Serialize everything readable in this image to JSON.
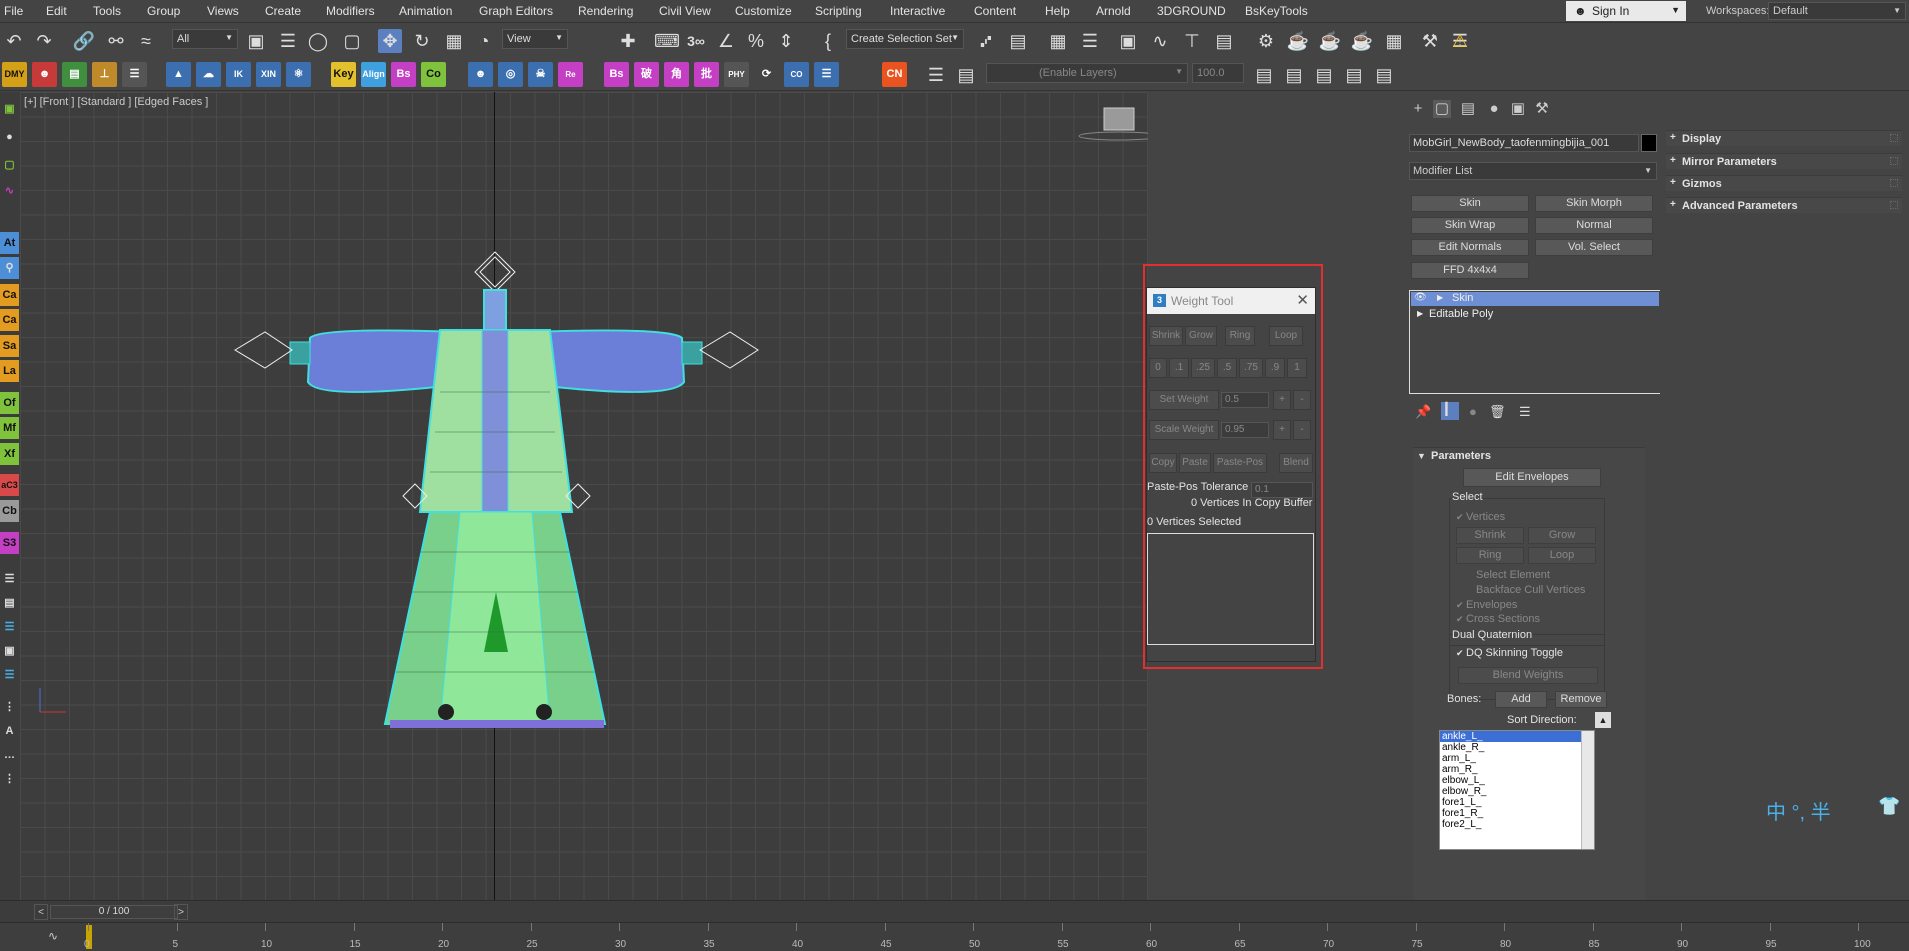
{
  "menu": [
    "File",
    "Edit",
    "Tools",
    "Group",
    "Views",
    "Create",
    "Modifiers",
    "Animation",
    "Graph Editors",
    "Rendering",
    "Civil View",
    "Customize",
    "Scripting",
    "Interactive",
    "Content",
    "Help",
    "Arnold",
    "3DGROUND",
    "BsKeyTools"
  ],
  "account": {
    "sign_in": "Sign In",
    "workspaces_label": "Workspaces:",
    "workspace": "Default"
  },
  "toolbar": {
    "filter": "All",
    "ref_coord": "View",
    "selection_set": "Create Selection Set",
    "layers_placeholder": "(Enable Layers)",
    "layer_value": "100.0"
  },
  "toolbar2_buttons": [
    {
      "label": "Key",
      "color": "#e3c12c"
    },
    {
      "label": "Align",
      "color": "#3fa0e0"
    },
    {
      "label": "Bs",
      "color": "#c43fc4"
    },
    {
      "label": "Co",
      "color": "#7fc23c"
    },
    {
      "label": "Bs",
      "color": "#c43fc4"
    },
    {
      "label": "破",
      "color": "#c43fc4"
    },
    {
      "label": "角",
      "color": "#c43fc4"
    },
    {
      "label": "批",
      "color": "#c43fc4"
    },
    {
      "label": "CN",
      "color": "#e8531f"
    }
  ],
  "left_strip": [
    {
      "label": "At",
      "color": "#4d8fd6"
    },
    {
      "label": "Ca",
      "color": "#e39b20"
    },
    {
      "label": "Ca",
      "color": "#e39b20"
    },
    {
      "label": "Sa",
      "color": "#e39b20"
    },
    {
      "label": "La",
      "color": "#e39b20"
    },
    {
      "label": "Of",
      "color": "#7fc23c"
    },
    {
      "label": "Mf",
      "color": "#7fc23c"
    },
    {
      "label": "Xf",
      "color": "#7fc23c"
    },
    {
      "label": "aC3",
      "color": "#d84a4a"
    },
    {
      "label": "Cb",
      "color": "#9a9a9a"
    },
    {
      "label": "S3",
      "color": "#c43fc4"
    }
  ],
  "viewport": {
    "label": "[+] [Front ] [Standard ] [Edged Faces ]"
  },
  "weight_tool": {
    "title": "Weight Tool",
    "row1": [
      "Shrink",
      "Grow",
      "Ring",
      "Loop"
    ],
    "row2": [
      "0",
      ".1",
      ".25",
      ".5",
      ".75",
      ".9",
      "1"
    ],
    "set_weight_label": "Set Weight",
    "set_weight_value": "0.5",
    "scale_weight_label": "Scale Weight",
    "scale_weight_value": "0.95",
    "plus": "+",
    "minus": "-",
    "row5": [
      "Copy",
      "Paste",
      "Paste-Pos",
      "Blend"
    ],
    "tolerance_label": "Paste-Pos Tolerance",
    "tolerance_value": "0.1",
    "copy_buffer": "0 Vertices In Copy Buffer",
    "selected": "0 Vertices Selected"
  },
  "command_panel": {
    "object_name": "MobGirl_NewBody_taofenmingbijia_001",
    "modifier_list": "Modifier List",
    "modifier_buttons": [
      "Skin",
      "Skin Morph",
      "Skin Wrap",
      "Normal",
      "Edit Normals",
      "Vol. Select",
      "FFD 4x4x4"
    ],
    "stack": [
      "Skin",
      "Editable Poly"
    ]
  },
  "parameters": {
    "title": "Parameters",
    "edit_envelopes": "Edit Envelopes",
    "select_label": "Select",
    "vertices": "Vertices",
    "shrink": "Shrink",
    "grow": "Grow",
    "ring": "Ring",
    "loop": "Loop",
    "select_element": "Select Element",
    "backface_cull": "Backface Cull Vertices",
    "envelopes": "Envelopes",
    "cross_sections": "Cross Sections",
    "dual_quaternion": "Dual Quaternion",
    "dq_toggle": "DQ Skinning Toggle",
    "blend_weights": "Blend Weights",
    "bones_label": "Bones:",
    "add": "Add",
    "remove": "Remove",
    "sort_direction": "Sort Direction:",
    "bones": [
      "ankle_L_",
      "ankle_R_",
      "arm_L_",
      "arm_R_",
      "elbow_L_",
      "elbow_R_",
      "fore1_L_",
      "fore1_R_",
      "fore2_L_"
    ]
  },
  "rollouts": [
    "Display",
    "Mirror Parameters",
    "Gizmos",
    "Advanced Parameters"
  ],
  "timeline": {
    "time_label": "0 / 100",
    "ticks": [
      "0",
      "5",
      "10",
      "15",
      "20",
      "25",
      "30",
      "35",
      "40",
      "45",
      "50",
      "55",
      "60",
      "65",
      "70",
      "75",
      "80",
      "85",
      "90",
      "95",
      "100"
    ]
  },
  "ime": {
    "text": "中 °, 半"
  }
}
